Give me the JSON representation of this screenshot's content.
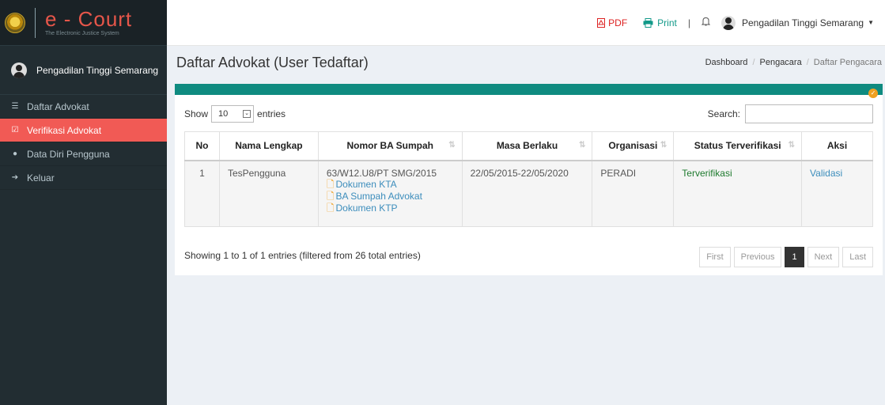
{
  "app": {
    "title_e": "e",
    "title_dash": " - ",
    "title_court": "Court",
    "subtitle": "The Electronic Justice System"
  },
  "user": {
    "name": "Pengadilan Tinggi Semarang"
  },
  "sidebar": {
    "items": [
      {
        "label": "Daftar Advokat",
        "icon": "list-icon",
        "active": false
      },
      {
        "label": "Verifikasi Advokat",
        "icon": "check-square-icon",
        "active": true
      },
      {
        "label": "Data Diri Pengguna",
        "icon": "user-icon",
        "active": false
      },
      {
        "label": "Keluar",
        "icon": "sign-out-icon",
        "active": false
      }
    ]
  },
  "topbar": {
    "pdf": "PDF",
    "print": "Print",
    "separator": "|",
    "user": "Pengadilan Tinggi Semarang"
  },
  "page": {
    "title": "Daftar Advokat (User Tedaftar)"
  },
  "breadcrumb": [
    "Dashboard",
    "Pengacara",
    "Daftar Pengacara"
  ],
  "table_controls": {
    "show_label": "Show",
    "entries_label": "entries",
    "length_value": "10",
    "search_label": "Search:",
    "search_value": ""
  },
  "table": {
    "columns": [
      "No",
      "Nama Lengkap",
      "Nomor BA Sumpah",
      "Masa Berlaku",
      "Organisasi",
      "Status Terverifikasi",
      "Aksi"
    ],
    "rows": [
      {
        "no": "1",
        "nama": "TesPengguna",
        "nomor": "63/W12.U8/PT SMG/2015",
        "docs": [
          "Dokumen KTA",
          "BA Sumpah Advokat",
          "Dokumen KTP"
        ],
        "masa": "22/05/2015-22/05/2020",
        "organisasi": "PERADI",
        "status": "Terverifikasi",
        "aksi": "Validasi"
      }
    ]
  },
  "info": "Showing 1 to 1 of 1 entries (filtered from 26 total entries)",
  "pagination": {
    "first": "First",
    "previous": "Previous",
    "current": "1",
    "next": "Next",
    "last": "Last"
  },
  "colors": {
    "accent": "#0f8b80",
    "active_menu": "#f15a55",
    "sidebar": "#222d32"
  }
}
